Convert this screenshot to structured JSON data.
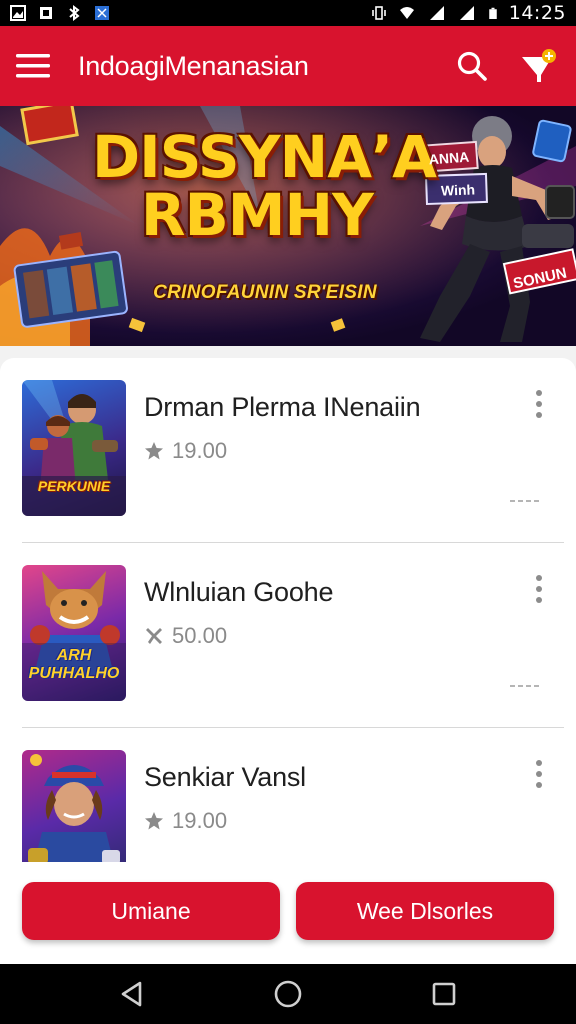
{
  "status_bar": {
    "time": "14:25",
    "left_icons": [
      "image-icon",
      "usb-icon",
      "bluetooth-icon",
      "tag-icon"
    ],
    "right_icons": [
      "vibrate-icon",
      "wifi-icon",
      "signal-icon",
      "signal-icon",
      "battery-icon"
    ]
  },
  "app_bar": {
    "title": "Indoagi​Menanasian",
    "menu_icon": "hamburger-icon",
    "search_icon": "search-icon",
    "cart_icon": "cart-icon",
    "accent_color": "#d8132e"
  },
  "banner": {
    "title_line1": "DISSYNAʼA",
    "title_line2": "RBMHY",
    "subtitle": "CRINOFAUNIN SR'EISIN",
    "sign_labels": [
      "ANNA",
      "Winh",
      "SONUN"
    ]
  },
  "items": [
    {
      "title": "Drman Plerma INenaiin",
      "rating_icon": "star-icon",
      "rating": "19.00",
      "thumb_label": "PERKUNIE"
    },
    {
      "title": "Wlnluian Goohe",
      "rating_icon": "tools-icon",
      "rating": "50.00",
      "thumb_label": "ARH PUHHALHO"
    },
    {
      "title": "Senkiar Vansl",
      "rating_icon": "star-icon",
      "rating": "19.00",
      "thumb_label": ""
    }
  ],
  "buttons": {
    "left_label": "Umiane",
    "right_label": "Wee Dlsorles"
  },
  "nav_bar": {
    "back_icon": "back-icon",
    "home_icon": "home-icon",
    "recents_icon": "recents-icon"
  }
}
